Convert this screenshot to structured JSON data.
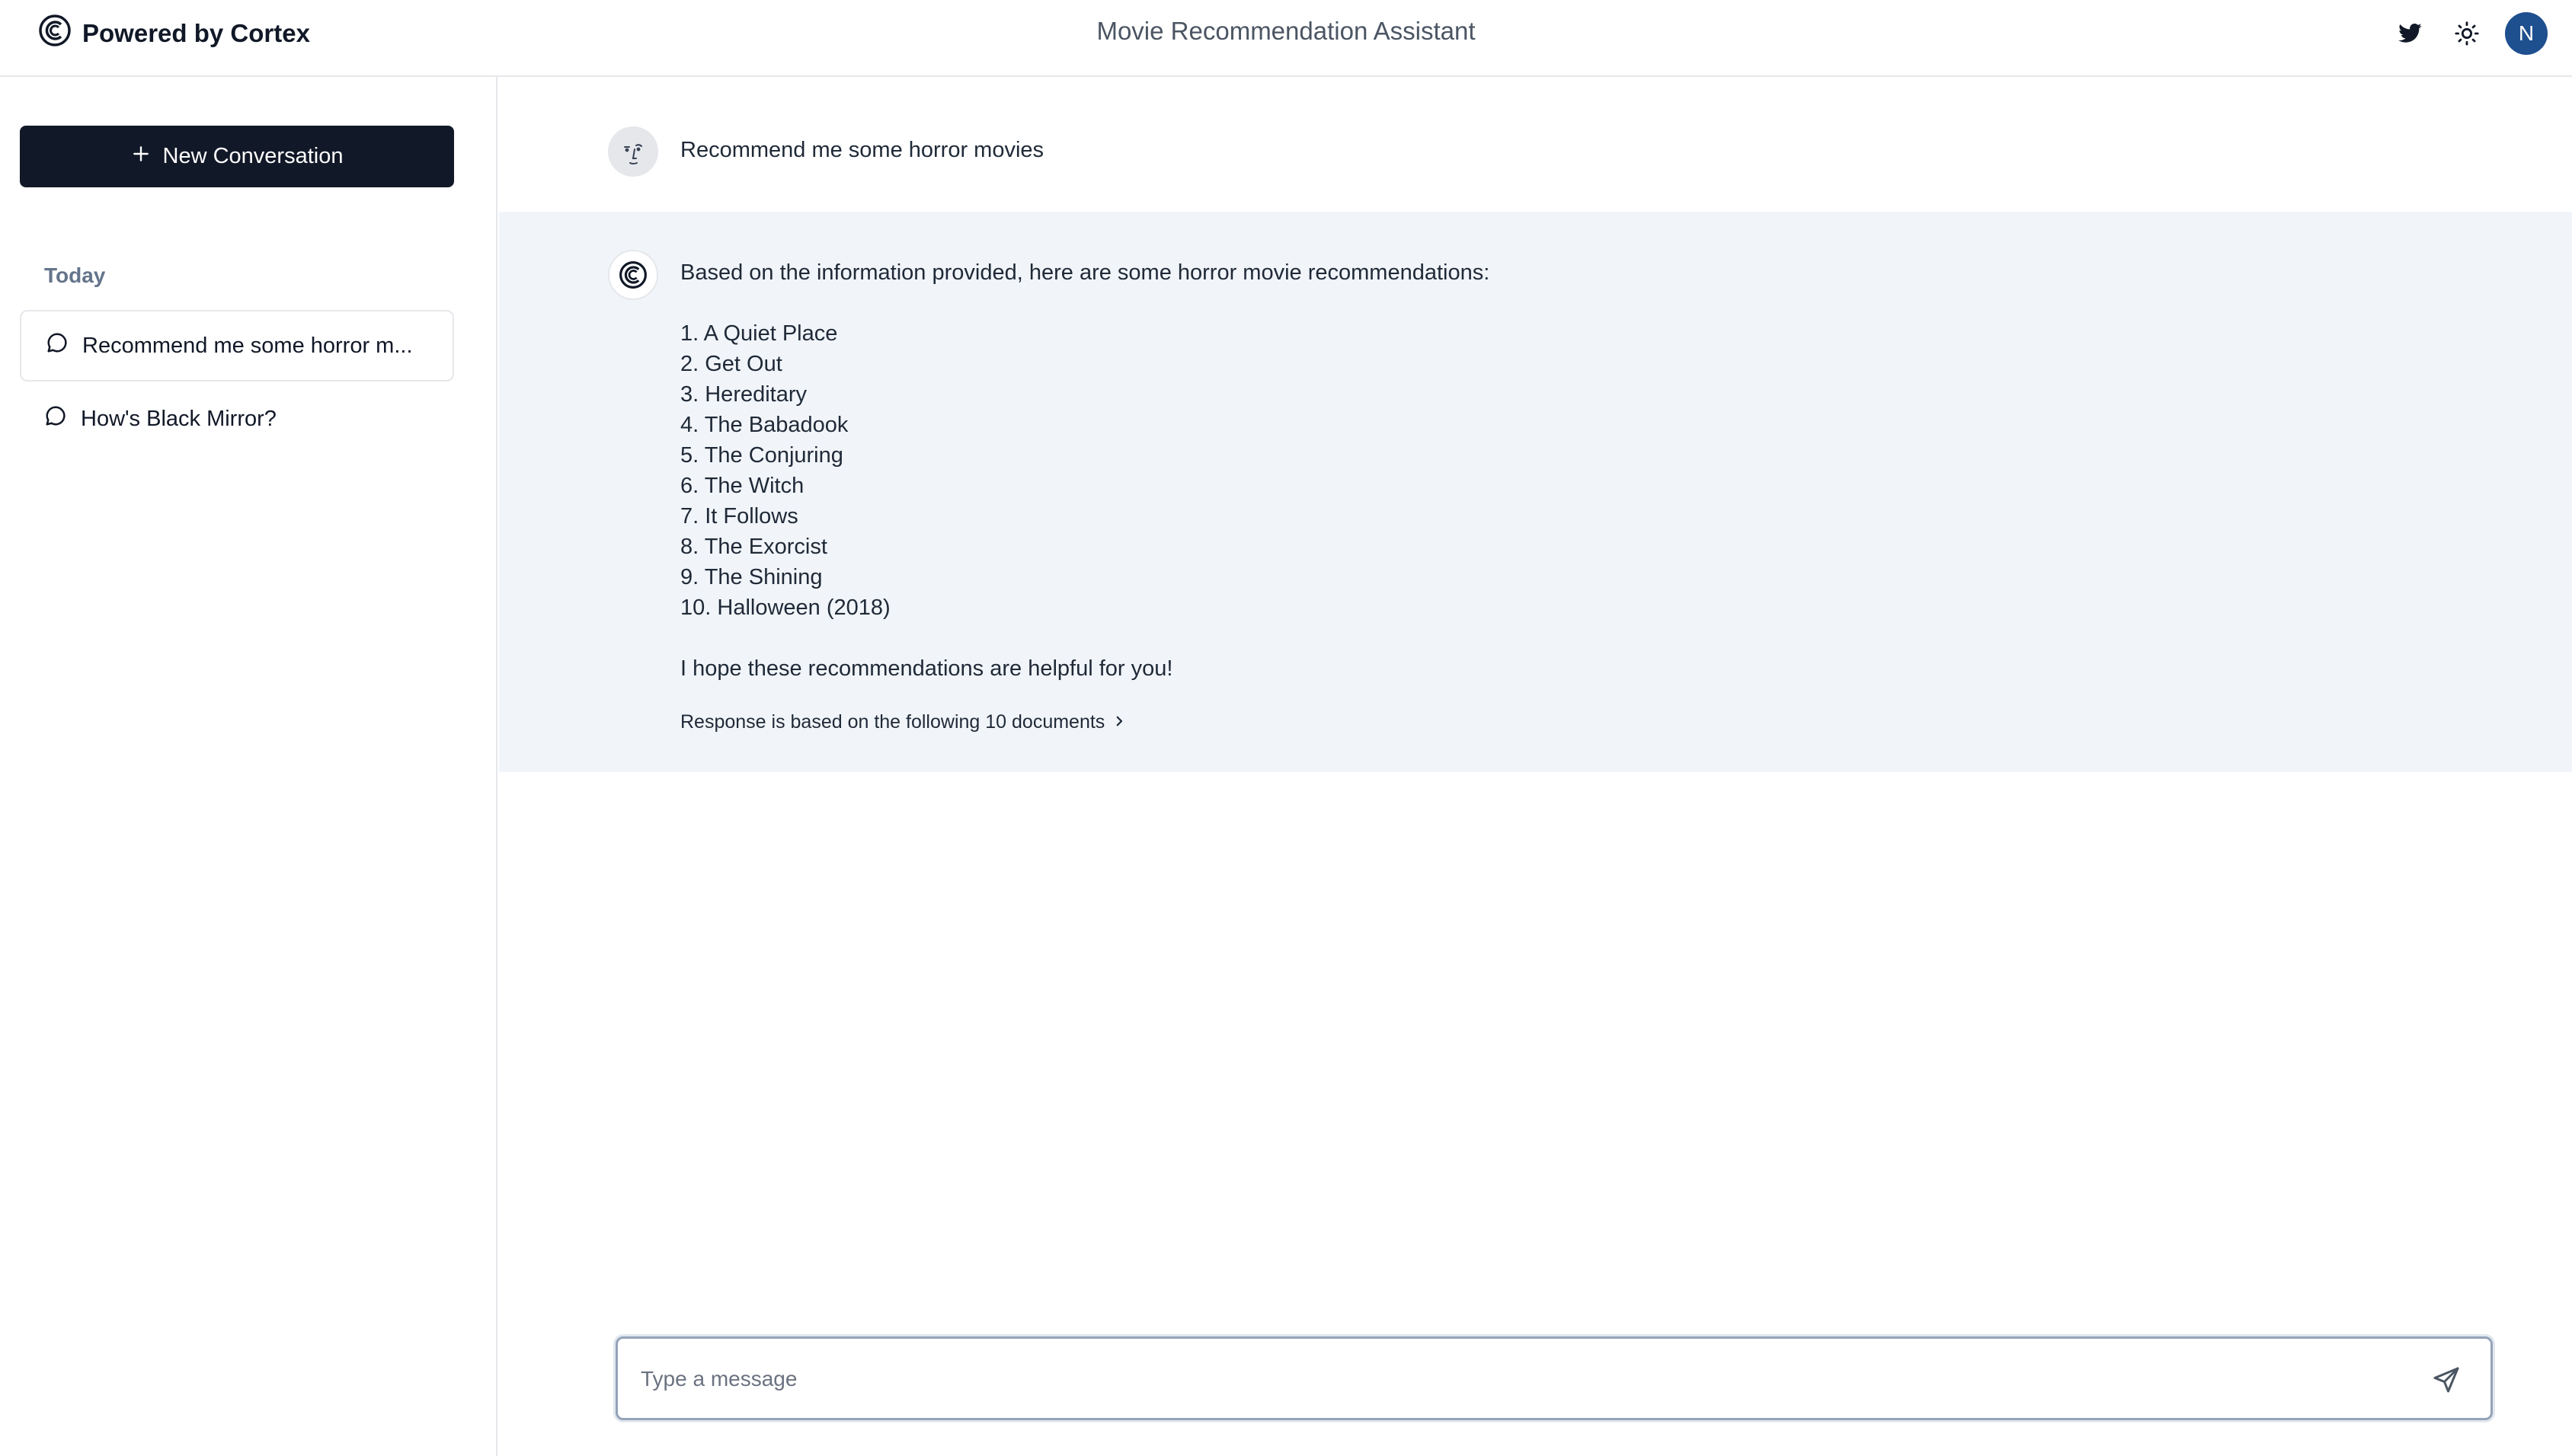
{
  "header": {
    "brand": "Powered by Cortex",
    "title": "Movie Recommendation Assistant",
    "avatar_initial": "N",
    "icons": [
      "twitter-icon",
      "sun-icon"
    ],
    "accent_color": "#1e4f8f"
  },
  "sidebar": {
    "new_conversation_label": "New Conversation",
    "section_label": "Today",
    "conversations": [
      {
        "label": "Recommend me some horror m...",
        "active": true
      },
      {
        "label": "How's Black Mirror?",
        "active": false
      }
    ]
  },
  "chat": {
    "user_message": "Recommend me some horror movies",
    "bot_intro": "Based on the information provided, here are some horror movie recommendations:",
    "bot_list": [
      "1. A Quiet Place",
      "2. Get Out",
      "3. Hereditary",
      "4. The Babadook",
      "5. The Conjuring",
      "6. The Witch",
      "7. It Follows",
      "8. The Exorcist",
      "9. The Shining",
      "10. Halloween (2018)"
    ],
    "bot_outro": "I hope these recommendations are helpful for you!",
    "sources_label": "Response is based on the following 10 documents"
  },
  "composer": {
    "placeholder": "Type a message",
    "value": ""
  }
}
